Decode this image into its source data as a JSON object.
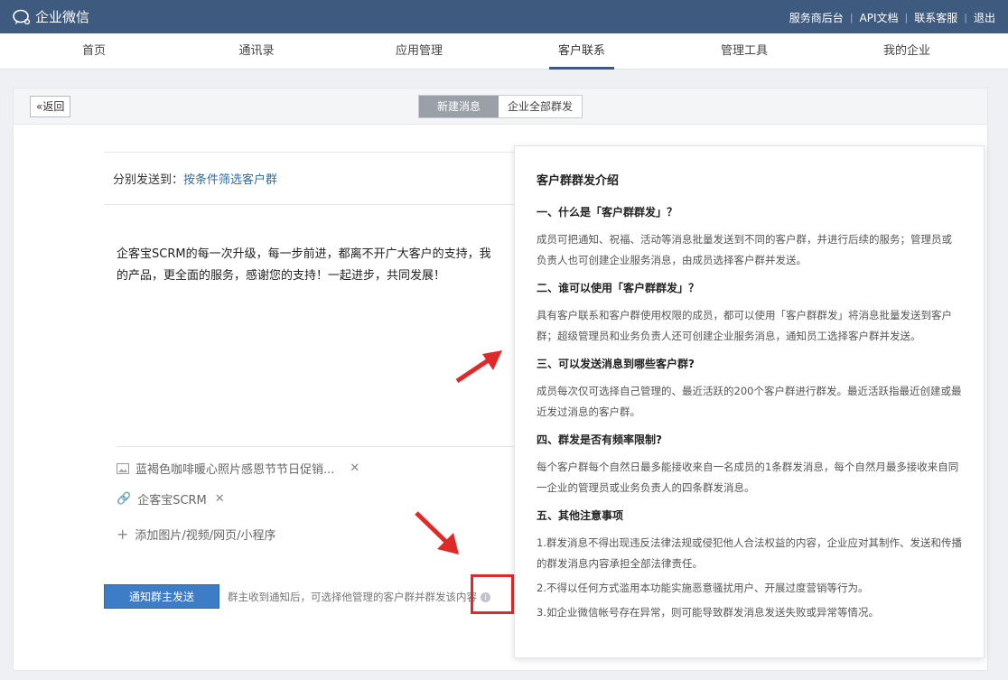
{
  "topbar": {
    "logo_text": "企业微信",
    "links": [
      "服务商后台",
      "API文档",
      "联系客服",
      "退出"
    ]
  },
  "nav": {
    "tabs": [
      "首页",
      "通讯录",
      "应用管理",
      "客户联系",
      "管理工具",
      "我的企业"
    ],
    "active": "客户联系"
  },
  "panel": {
    "back_label": "返回",
    "seg_new": "新建消息",
    "seg_all": "企业全部群发"
  },
  "form": {
    "sendto_label": "分别发送到：",
    "sendto_value": "按条件筛选客户群",
    "message_line1": "企客宝SCRM的每一次升级，每一步前进，都离不开广大客户的支持，我",
    "message_line2": "的产品，更全面的服务，感谢您的支持！一起进步，共同发展！",
    "attachment_image": "蓝褐色咖啡暖心照片感恩节节日促销...",
    "attachment_link": "企客宝SCRM",
    "add_media": "添加图片/视频/网页/小程序",
    "notify_button": "通知群主发送",
    "tip": "群主收到通知后，可选择他管理的客户群并群发该内容"
  },
  "intro": {
    "title": "客户群群发介绍",
    "s1_title": "一、什么是「客户群群发」？",
    "s1_body": "成员可把通知、祝福、活动等消息批量发送到不同的客户群，并进行后续的服务；管理员或负责人也可创建企业服务消息，由成员选择客户群并发送。",
    "s2_title": "二、谁可以使用「客户群群发」？",
    "s2_body": "具有客户联系和客户群使用权限的成员，都可以使用「客户群群发」将消息批量发送到客户群；超级管理员和业务负责人还可创建企业服务消息，通知员工选择客户群并发送。",
    "s3_title": "三、可以发送消息到哪些客户群?",
    "s3_body": "成员每次仅可选择自己管理的、最近活跃的200个客户群进行群发。最近活跃指最近创建或最近发过消息的客户群。",
    "s4_title": "四、群发是否有频率限制?",
    "s4_body": "每个客户群每个自然日最多能接收来自一名成员的1条群发消息，每个自然月最多接收来自同一企业的管理员或业务负责人的四条群发消息。",
    "s5_title": "五、其他注意事项",
    "s5_note1": "1.群发消息不得出现违反法律法规或侵犯他人合法权益的内容，企业应对其制作、发送和传播的群发消息内容承担全部法律责任。",
    "s5_note2": "2.不得以任何方式滥用本功能实施恶意骚扰用户、开展过度营销等行为。",
    "s5_note3": "3.如企业微信帐号存在异常，则可能导致群发消息发送失败或异常等情况。"
  },
  "colors": {
    "topbar": "#3f5a7f",
    "primary_button": "#3d7cc6",
    "annotation_red": "#e02a2a"
  }
}
